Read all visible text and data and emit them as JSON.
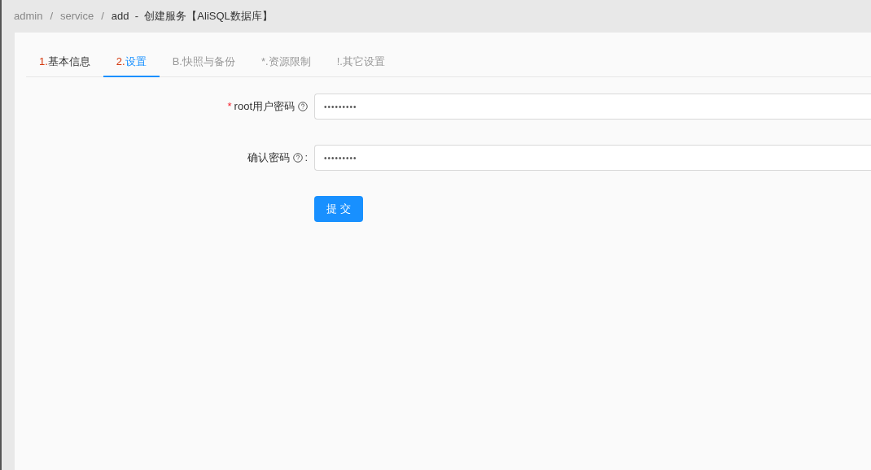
{
  "breadcrumb": [
    {
      "text": "admin",
      "current": false
    },
    {
      "separator": "/",
      "text": "service",
      "current": false
    },
    {
      "separator": "/",
      "text": "add  -  创建服务【AliSQL数据库】",
      "current": true
    }
  ],
  "tabs": [
    {
      "index": "1.",
      "label": "基本信息",
      "kind": "step",
      "selected": false
    },
    {
      "index": "2.",
      "label": "设置",
      "kind": "step",
      "selected": true
    },
    {
      "index": "B.",
      "label": "快照与备份",
      "kind": "extra",
      "selected": false
    },
    {
      "index": "*.",
      "label": "资源限制",
      "kind": "extra",
      "selected": false
    },
    {
      "index": "!.",
      "label": "其它设置",
      "kind": "extra",
      "selected": false
    }
  ],
  "fields": [
    {
      "required_mark": "*",
      "label": "root用户密码",
      "value": "•••••••••"
    },
    {
      "label": "确认密码",
      "suffix": ":",
      "value": "•••••••••"
    }
  ],
  "submit": "提 交"
}
